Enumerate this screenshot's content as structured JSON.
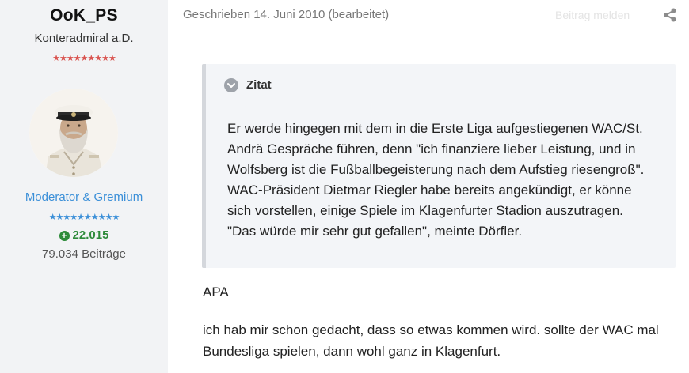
{
  "author": {
    "username": "OoK_PS",
    "rank_title": "Konteradmiral a.D.",
    "rank_stars": "★★★★★★★★★",
    "group": "Moderator & Gremium",
    "group_stars": "★★★★★★★★★★",
    "reputation": "22.015",
    "post_count": "79.034 Beiträge",
    "avatar_icon": "captain-portrait"
  },
  "post": {
    "meta": "Geschrieben 14. Juni 2010 (bearbeitet)",
    "report_label": "Beitrag melden",
    "share_icon": "share-icon",
    "quote": {
      "title": "Zitat",
      "lines": [
        "Er werde hingegen mit dem in die Erste Liga aufgestiegenen WAC/St.",
        "Andrä Gespräche führen, denn \"ich finanziere lieber Leistung, und in",
        "Wolfsberg ist die Fußballbegeisterung nach dem Aufstieg riesengroß\".",
        "WAC-Präsident Dietmar Riegler habe bereits angekündigt, er könne",
        "sich vorstellen, einige Spiele im Klagenfurter Stadion auszutragen.",
        "\"Das würde mir sehr gut gefallen\", meinte Dörfler."
      ]
    },
    "source": "APA",
    "comment_lines": [
      "ich hab mir schon gedacht, dass so etwas kommen wird. sollte der WAC mal",
      "Bundesliga spielen, dann wohl ganz in Klagenfurt."
    ]
  },
  "colors": {
    "sidebar_bg": "#f2f3f5",
    "group_blue": "#3b8fd8",
    "reputation_green": "#2e8b3a",
    "rank_star_red": "#d9534f",
    "quote_bg": "#f3f5f8"
  }
}
